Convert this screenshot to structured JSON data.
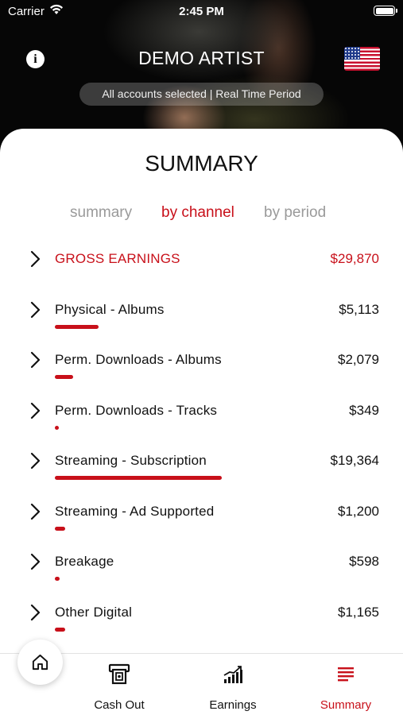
{
  "status_bar": {
    "carrier": "Carrier",
    "time": "2:45 PM"
  },
  "header": {
    "artist_name": "DEMO ARTIST",
    "filter_text": "All accounts selected | Real Time Period",
    "info_icon": "info-icon",
    "flag_icon": "us-flag-icon"
  },
  "summary": {
    "title": "SUMMARY",
    "tabs": [
      {
        "label": "summary",
        "active": false
      },
      {
        "label": "by channel",
        "active": true
      },
      {
        "label": "by period",
        "active": false
      }
    ],
    "gross": {
      "label": "GROSS EARNINGS",
      "value": "$29,870"
    },
    "channels": [
      {
        "label": "Physical - Albums",
        "value": "$5,113",
        "share": 0.171
      },
      {
        "label": "Perm. Downloads - Albums",
        "value": "$2,079",
        "share": 0.07
      },
      {
        "label": "Perm. Downloads - Tracks",
        "value": "$349",
        "share": 0.012
      },
      {
        "label": "Streaming - Subscription",
        "value": "$19,364",
        "share": 0.648
      },
      {
        "label": "Streaming - Ad Supported",
        "value": "$1,200",
        "share": 0.04
      },
      {
        "label": "Breakage",
        "value": "$598",
        "share": 0.02
      },
      {
        "label": "Other Digital",
        "value": "$1,165",
        "share": 0.039
      }
    ]
  },
  "tabbar": {
    "home_icon": "home-icon",
    "items": [
      {
        "label": "Cash Out",
        "icon": "atm-icon",
        "active": false
      },
      {
        "label": "Earnings",
        "icon": "bar-chart-icon",
        "active": false
      },
      {
        "label": "Summary",
        "icon": "list-icon",
        "active": true
      }
    ]
  },
  "colors": {
    "accent": "#c8101a",
    "inactive_tab": "#9a9a9a",
    "sheet": "#ffffff"
  }
}
